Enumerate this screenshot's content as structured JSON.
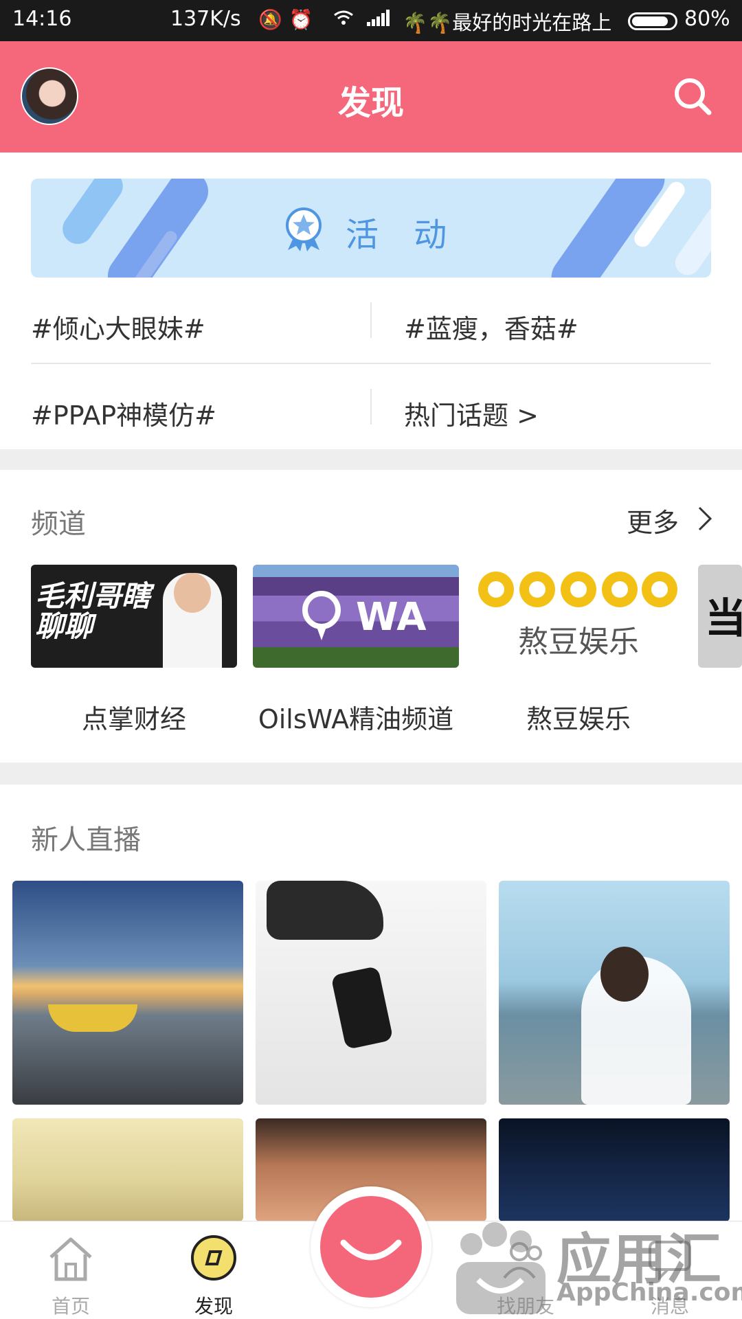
{
  "status_bar": {
    "time": "14:16",
    "speed": "137K/s",
    "carrier": "🌴🌴最好的时光在路上",
    "battery": "80%",
    "icons": [
      "mute-icon",
      "alarm-icon",
      "wifi-icon",
      "signal-icon"
    ]
  },
  "header": {
    "title": "发现",
    "search_icon": "search-icon",
    "bg_color": "#f5687b"
  },
  "activity_banner": {
    "label": "活 动",
    "icon": "medal-star-icon",
    "accent_color": "#4e96e2"
  },
  "topics": [
    "#倾心大眼妹#",
    "#蓝瘦，香菇#",
    "#PPAP神模仿#",
    "热门话题 >"
  ],
  "channels": {
    "title": "频道",
    "more_label": "更多",
    "items": [
      {
        "name": "点掌财经",
        "thumb_text": "毛利哥瞎聊聊"
      },
      {
        "name": "OilsWA精油频道",
        "thumb_text": "WA"
      },
      {
        "name": "熬豆娱乐",
        "thumb_text": "熬豆娱乐"
      },
      {
        "name": "",
        "thumb_text": "当"
      }
    ]
  },
  "new_live": {
    "title": "新人直播",
    "tiles": [
      "sunset-boat-photo",
      "sketch-portrait-photo",
      "bride-photo",
      "window-photo",
      "selfie-photo",
      "suit-photo"
    ]
  },
  "bottom_nav": {
    "items": [
      {
        "label": "首页",
        "icon": "home-icon",
        "active": false
      },
      {
        "label": "发现",
        "icon": "compass-icon",
        "active": true
      },
      {
        "label": "找朋友",
        "icon": "friends-icon",
        "active": false
      },
      {
        "label": "消息",
        "icon": "message-icon",
        "active": false
      }
    ],
    "live_button_icon": "smile-live-icon"
  },
  "watermark": {
    "text": "应用汇",
    "sub": "AppChina.com"
  }
}
